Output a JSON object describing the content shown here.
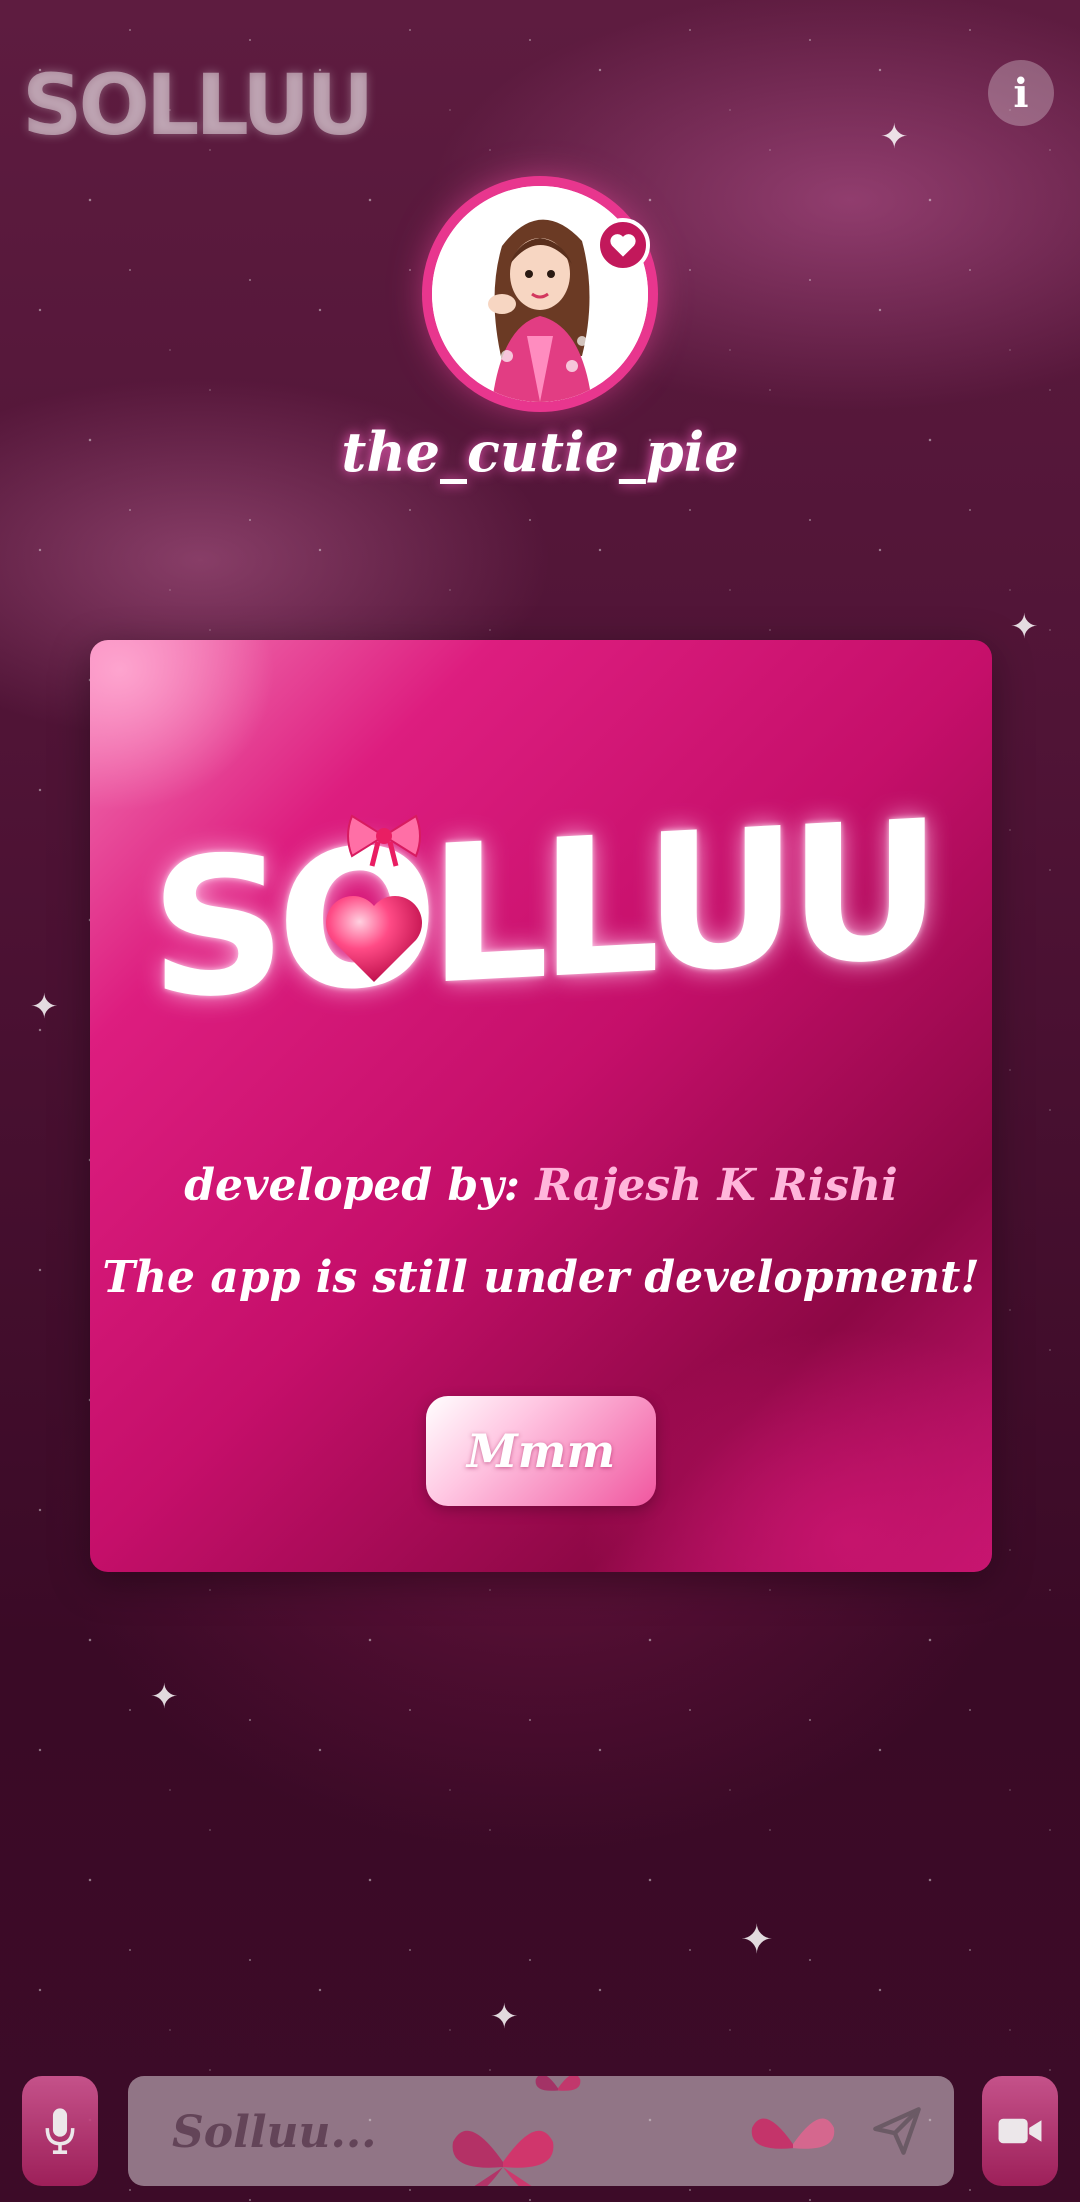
{
  "app": {
    "logo_text": "SOLLUU",
    "info_label": "i"
  },
  "profile": {
    "username": "the_cutie_pie",
    "badge_icon": "heart-icon"
  },
  "card": {
    "logo_text": "SOLLUU",
    "credit_prefix": "developed by: ",
    "credit_author": "Rajesh K Rishi",
    "note": "The app is still under development!",
    "button_label": "Mmm"
  },
  "composer": {
    "placeholder": "Solluu...",
    "mic_icon": "mic-icon",
    "send_icon": "send-icon",
    "video_icon": "video-icon"
  },
  "colors": {
    "accent": "#e8368e",
    "card": "#c50f6a",
    "author": "#ffb6db"
  }
}
